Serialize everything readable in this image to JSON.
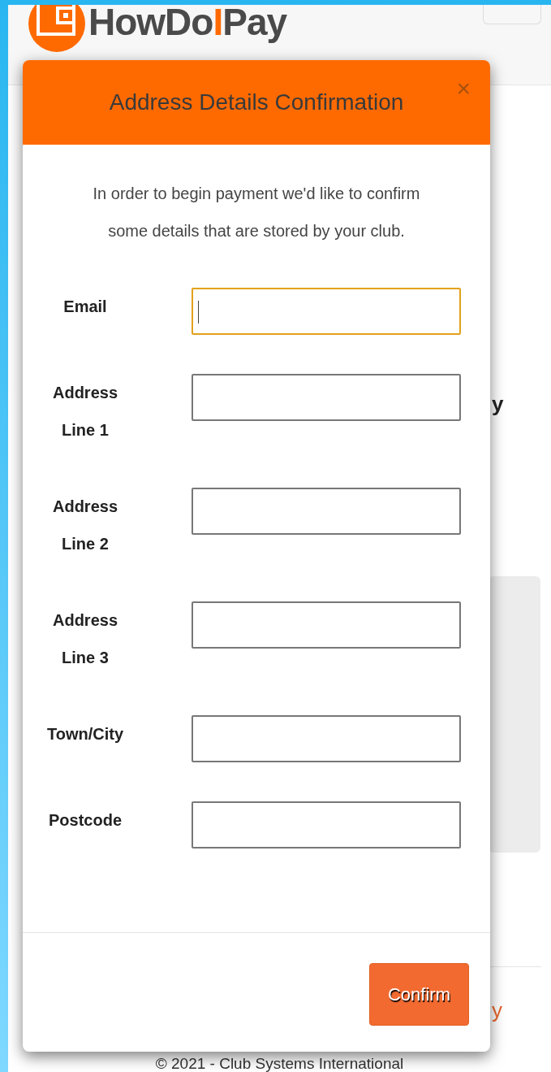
{
  "page": {
    "logo": {
      "before": "HowDo",
      "accent": "I",
      "after": "Pay"
    },
    "background_texts": [
      {
        "kind": "plain",
        "text": "y"
      },
      {
        "kind": "link",
        "text": "y"
      }
    ],
    "footer": "© 2021 - Club Systems International"
  },
  "modal": {
    "title": "Address Details Confirmation",
    "close": "×",
    "intro": "In order to begin payment we'd like to confirm some details that are stored by your club.",
    "fields": [
      {
        "label": "Email",
        "focused": true
      },
      {
        "label": "Address Line 1",
        "focused": false
      },
      {
        "label": "Address Line 2",
        "focused": false
      },
      {
        "label": "Address Line 3",
        "focused": false
      },
      {
        "label": "Town/City",
        "focused": false
      },
      {
        "label": "Postcode",
        "focused": false
      }
    ],
    "button": "Confirm"
  }
}
